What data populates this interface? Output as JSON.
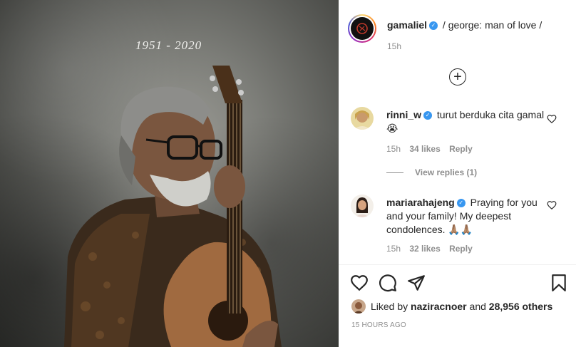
{
  "photo": {
    "overlay_text": "1951 - 2020"
  },
  "header": {
    "username": "gamaliel",
    "caption": "/ george: man of love /",
    "time": "15h"
  },
  "comments": [
    {
      "username": "rinni_w",
      "text": "turut berduka cita gamal 😭",
      "time": "15h",
      "likes": "34 likes",
      "reply": "Reply",
      "view_replies": "View replies (1)"
    },
    {
      "username": "mariarahajeng",
      "text": "Praying for you and your family! My deepest condolences. 🙏🏽🙏🏽",
      "time": "15h",
      "likes": "32 likes",
      "reply": "Reply"
    }
  ],
  "likes": {
    "prefix": "Liked by",
    "user": "naziracnoer",
    "and": "and",
    "others": "28,956 others"
  },
  "posted_time": "15 HOURS AGO",
  "icons": {
    "like": "heart-outline-icon",
    "comment": "comment-bubble-icon",
    "share": "paper-plane-icon",
    "save": "bookmark-icon",
    "load_more": "plus-circle-icon"
  },
  "colors": {
    "verified": "#3897f0",
    "text": "#262626",
    "muted": "#8e8e8e"
  }
}
